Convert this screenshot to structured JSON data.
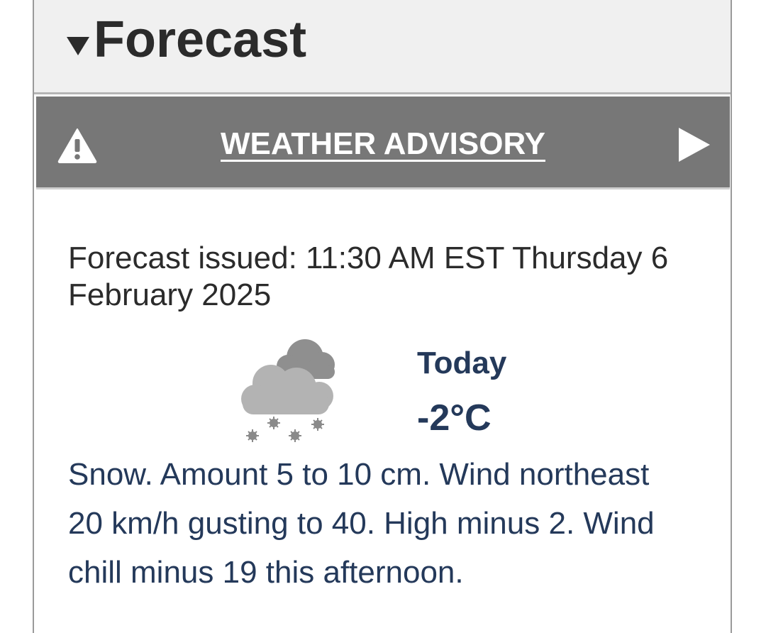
{
  "section": {
    "title": "Forecast",
    "toggle_icon": "caret-down-icon"
  },
  "advisory": {
    "label": "WEATHER ADVISORY",
    "left_icon": "warning-icon",
    "right_icon": "play-arrow-icon",
    "background_color": "#777777"
  },
  "forecast": {
    "issued": "Forecast issued: 11:30 AM EST Thursday 6 February 2025",
    "period": "Today",
    "temperature": "-2°C",
    "condition_icon": "snow-cloud-icon",
    "summary": "Snow. Amount 5 to 10 cm. Wind northeast 20 km/h gusting to 40. High minus 2. Wind chill minus 19 this afternoon."
  },
  "colors": {
    "text_dark": "#2b2b2b",
    "text_accent": "#24395a"
  }
}
